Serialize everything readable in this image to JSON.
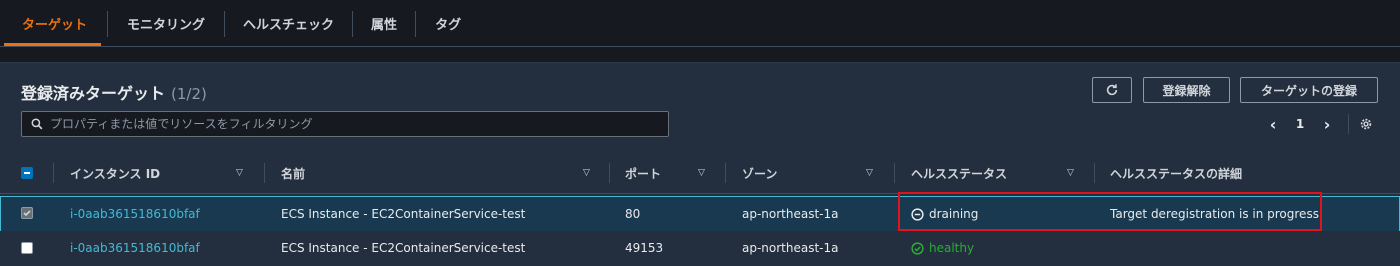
{
  "tabs": [
    {
      "label": "ターゲット",
      "active": true
    },
    {
      "label": "モニタリング",
      "active": false
    },
    {
      "label": "ヘルスチェック",
      "active": false
    },
    {
      "label": "属性",
      "active": false
    },
    {
      "label": "タグ",
      "active": false
    }
  ],
  "panel": {
    "title": "登録済みターゲット",
    "count": "(1/2)",
    "refresh_icon": "refresh-icon",
    "deregister_label": "登録解除",
    "register_label": "ターゲットの登録",
    "search_placeholder": "プロパティまたは値でリソースをフィルタリング",
    "page": "1"
  },
  "table": {
    "headers": {
      "instance_id": "インスタンス ID",
      "name": "名前",
      "port": "ポート",
      "zone": "ゾーン",
      "health_status": "ヘルスステータス",
      "health_detail": "ヘルスステータスの詳細"
    },
    "rows": [
      {
        "selected": true,
        "instance_id": "i-0aab361518610bfaf",
        "name": "ECS Instance - EC2ContainerService-test",
        "port": "80",
        "zone": "ap-northeast-1a",
        "status": "draining",
        "status_icon": "minus-circle-icon",
        "detail": "Target deregistration is in progress"
      },
      {
        "selected": false,
        "instance_id": "i-0aab361518610bfaf",
        "name": "ECS Instance - EC2ContainerService-test",
        "port": "49153",
        "zone": "ap-northeast-1a",
        "status": "healthy",
        "status_icon": "check-circle-icon",
        "detail": ""
      }
    ]
  },
  "colors": {
    "accent": "#ec7211",
    "link": "#44b9d6",
    "healthy": "#29ad32",
    "highlight_border": "#e0141e"
  }
}
